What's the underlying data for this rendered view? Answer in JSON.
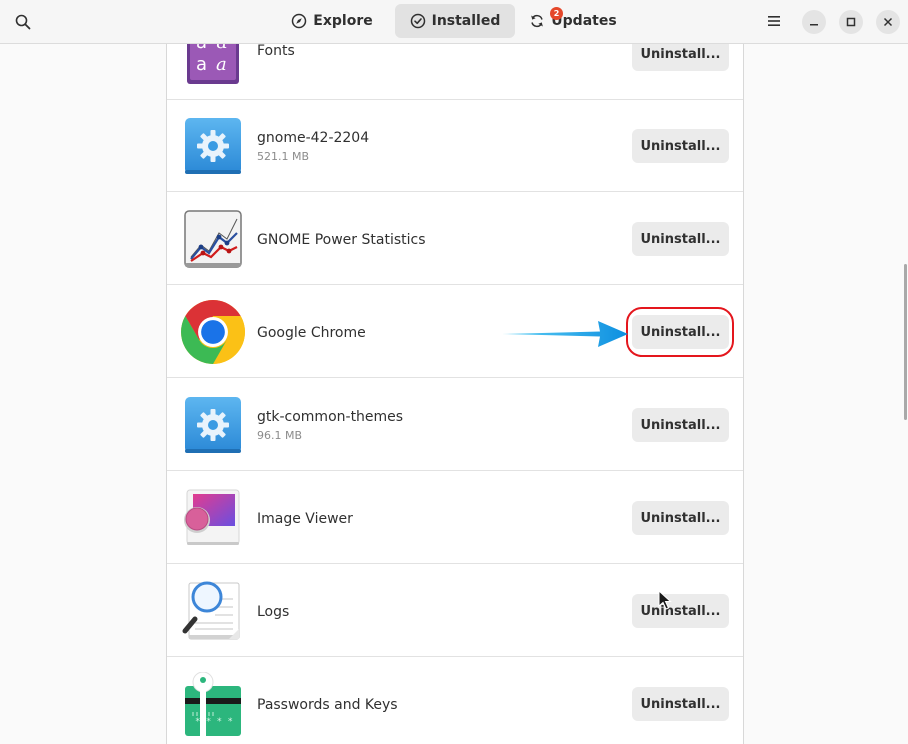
{
  "header": {
    "tabs": [
      {
        "label": "Explore",
        "icon": "compass-icon"
      },
      {
        "label": "Installed",
        "icon": "check-circle-icon"
      },
      {
        "label": "Updates",
        "icon": "refresh-icon",
        "badge": "2"
      }
    ],
    "active_tab": "Installed"
  },
  "apps": [
    {
      "name": "Fonts",
      "size": "",
      "icon": "fonts-icon",
      "action": "Uninstall..."
    },
    {
      "name": "gnome-42-2204",
      "size": "521.1 MB",
      "icon": "gear-icon",
      "action": "Uninstall..."
    },
    {
      "name": "GNOME Power Statistics",
      "size": "",
      "icon": "power-statistics-icon",
      "action": "Uninstall..."
    },
    {
      "name": "Google Chrome",
      "size": "",
      "icon": "chrome-icon",
      "action": "Uninstall..."
    },
    {
      "name": "gtk-common-themes",
      "size": "96.1 MB",
      "icon": "gear-icon",
      "action": "Uninstall..."
    },
    {
      "name": "Image Viewer",
      "size": "",
      "icon": "image-viewer-icon",
      "action": "Uninstall..."
    },
    {
      "name": "Logs",
      "size": "",
      "icon": "logs-icon",
      "action": "Uninstall..."
    },
    {
      "name": "Passwords and Keys",
      "size": "",
      "icon": "passwords-keys-icon",
      "action": "Uninstall..."
    }
  ],
  "colors": {
    "highlight": "#e4161d",
    "arrow": "#1aa3e8",
    "badge": "#e5472a"
  }
}
